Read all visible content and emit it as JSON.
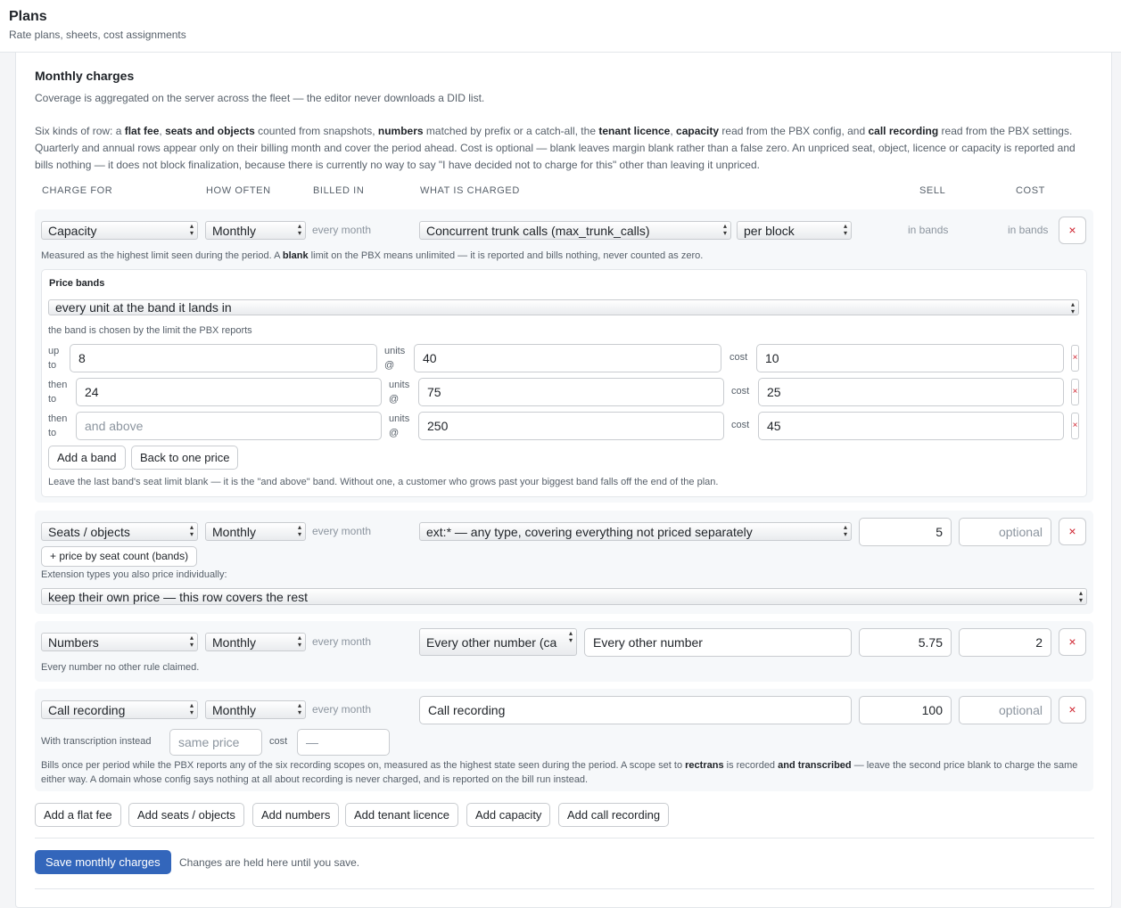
{
  "header": {
    "title": "Plans",
    "subtitle": "Rate plans, sheets, cost assignments"
  },
  "section": {
    "title": "Monthly charges",
    "intro": "Coverage is aggregated on the server across the fleet — the editor never downloads a DID list.",
    "desc": {
      "t1": "Six kinds of row: a ",
      "b1": "flat fee",
      "t2": ", ",
      "b2": "seats and objects",
      "t3": " counted from snapshots, ",
      "b3": "numbers",
      "t4": " matched by prefix or a catch-all, the ",
      "b4": "tenant licence",
      "t5": ", ",
      "b5": "capacity",
      "t6": " read from the PBX config, and ",
      "b6": "call recording",
      "t7": " read from the PBX settings. Quarterly and annual rows appear only on their billing month and cover the period ahead. Cost is optional — blank leaves margin blank rather than a false zero. An unpriced seat, object, licence or capacity is reported and bills nothing — it does not block finalization, because there is currently no way to say \"I have decided not to charge for this\" other than leaving it unpriced."
    }
  },
  "columns": {
    "charge_for": "Charge for",
    "how_often": "How often",
    "billed_in": "Billed in",
    "what": "What is charged",
    "sell": "Sell",
    "cost": "Cost"
  },
  "rows": {
    "capacity": {
      "kind": "Capacity",
      "freq": "Monthly",
      "billed": "every month",
      "what": "Concurrent trunk calls (max_trunk_calls)",
      "unit": "per block",
      "sell": "in bands",
      "cost": "in bands",
      "remove": "×",
      "note_a": "Measured as the highest limit seen during the period. A ",
      "note_b": "blank",
      "note_c": " limit on the PBX means unlimited — it is reported and bills nothing, never counted as zero.",
      "bands": {
        "title": "Price bands",
        "mode": "every unit at the band it lands in",
        "mode_note": "the band is chosen by the limit the PBX reports",
        "rows": [
          {
            "lbl_a": "up",
            "lbl_b": "to",
            "limit": "8",
            "units_a": "units",
            "units_b": "@",
            "price": "40",
            "cost_lbl": "cost",
            "cost": "10",
            "remove": "×"
          },
          {
            "lbl_a": "then",
            "lbl_b": "to",
            "limit": "24",
            "units_a": "units",
            "units_b": "@",
            "price": "75",
            "cost_lbl": "cost",
            "cost": "25",
            "remove": "×"
          },
          {
            "lbl_a": "then",
            "lbl_b": "to",
            "limit_placeholder": "and above",
            "units_a": "units",
            "units_b": "@",
            "price": "250",
            "cost_lbl": "cost",
            "cost": "45",
            "remove": "×"
          }
        ],
        "add_band": "Add a band",
        "back_to_one": "Back to one price",
        "footer": "Leave the last band's seat limit blank — it is the \"and above\" band. Without one, a customer who grows past your biggest band falls off the end of the plan."
      }
    },
    "seats": {
      "kind": "Seats / objects",
      "freq": "Monthly",
      "billed": "every month",
      "what": "ext:* — any type, covering everything not priced separately",
      "sell": "5",
      "cost_placeholder": "optional",
      "remove": "×",
      "price_by_bands": "+ price by seat count (bands)",
      "ext_label": "Extension types you also price individually:",
      "ext_mode": "keep their own price — this row covers the rest"
    },
    "numbers": {
      "kind": "Numbers",
      "freq": "Monthly",
      "billed": "every month",
      "match": "Every other number (ca",
      "name": "Every other number",
      "sell": "5.75",
      "cost": "2",
      "remove": "×",
      "note": "Every number no other rule claimed."
    },
    "recording": {
      "kind": "Call recording",
      "freq": "Monthly",
      "billed": "every month",
      "name": "Call recording",
      "sell": "100",
      "cost_placeholder": "optional",
      "remove": "×",
      "trans_label": "With transcription instead",
      "trans_placeholder": "same price",
      "trans_cost_label": "cost",
      "trans_cost_placeholder": "—",
      "note_a": "Bills once per period while the PBX reports any of the six recording scopes on, measured as the highest state seen during the period. A scope set to ",
      "note_b": "rectrans",
      "note_c": " is recorded ",
      "note_d": "and transcribed",
      "note_e": " — leave the second price blank to charge the same either way. A domain whose config says nothing at all about recording is never charged, and is reported on the bill run instead."
    }
  },
  "add_buttons": {
    "flat": "Add a flat fee",
    "seats": "Add seats / objects",
    "numbers": "Add numbers",
    "licence": "Add tenant licence",
    "capacity": "Add capacity",
    "recording": "Add call recording"
  },
  "save": {
    "label": "Save monthly charges",
    "note": "Changes are held here until you save."
  }
}
